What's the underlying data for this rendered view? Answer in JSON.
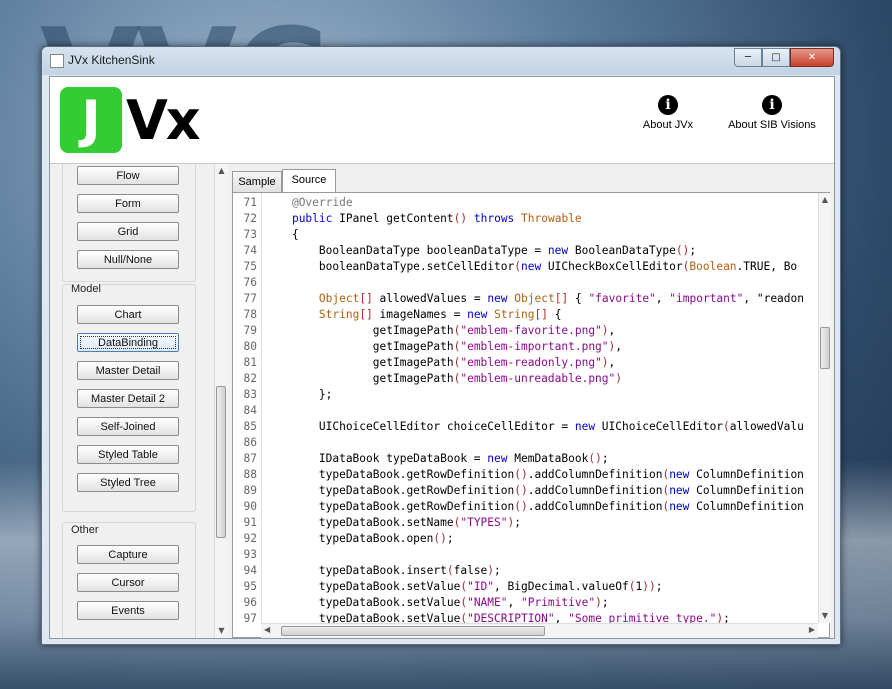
{
  "window": {
    "title": "JVx KitchenSink"
  },
  "header": {
    "logo_letter": "J",
    "logo_rest": "Vx",
    "about_jvx": "About JVx",
    "about_sib": "About SIB Visions"
  },
  "sidebar": {
    "top_buttons": [
      "Flow",
      "Form",
      "Grid",
      "Null/None"
    ],
    "model_label": "Model",
    "model_buttons": [
      "Chart",
      "DataBinding",
      "Master Detail",
      "Master Detail 2",
      "Self-Joined",
      "Styled Table",
      "Styled Tree"
    ],
    "other_label": "Other",
    "other_buttons": [
      "Capture",
      "Cursor",
      "Events"
    ]
  },
  "tabs": [
    "Sample",
    "Source"
  ],
  "code_lines": [
    {
      "n": "71",
      "code": "    @Override"
    },
    {
      "n": "72",
      "code": "    public IPanel getContent() throws Throwable"
    },
    {
      "n": "73",
      "code": "    {"
    },
    {
      "n": "74",
      "code": "        BooleanDataType booleanDataType = new BooleanDataType();"
    },
    {
      "n": "75",
      "code": "        booleanDataType.setCellEditor(new UICheckBoxCellEditor(Boolean.TRUE, Bo"
    },
    {
      "n": "76",
      "code": ""
    },
    {
      "n": "77",
      "code": "        Object[] allowedValues = new Object[] { \"favorite\", \"important\", \"readon"
    },
    {
      "n": "78",
      "code": "        String[] imageNames = new String[] {"
    },
    {
      "n": "79",
      "code": "                getImagePath(\"emblem-favorite.png\"),"
    },
    {
      "n": "80",
      "code": "                getImagePath(\"emblem-important.png\"),"
    },
    {
      "n": "81",
      "code": "                getImagePath(\"emblem-readonly.png\"),"
    },
    {
      "n": "82",
      "code": "                getImagePath(\"emblem-unreadable.png\")"
    },
    {
      "n": "83",
      "code": "        };"
    },
    {
      "n": "84",
      "code": ""
    },
    {
      "n": "85",
      "code": "        UIChoiceCellEditor choiceCellEditor = new UIChoiceCellEditor(allowedValu"
    },
    {
      "n": "86",
      "code": ""
    },
    {
      "n": "87",
      "code": "        IDataBook typeDataBook = new MemDataBook();"
    },
    {
      "n": "88",
      "code": "        typeDataBook.getRowDefinition().addColumnDefinition(new ColumnDefinition"
    },
    {
      "n": "89",
      "code": "        typeDataBook.getRowDefinition().addColumnDefinition(new ColumnDefinition"
    },
    {
      "n": "90",
      "code": "        typeDataBook.getRowDefinition().addColumnDefinition(new ColumnDefinition"
    },
    {
      "n": "91",
      "code": "        typeDataBook.setName(\"TYPES\");"
    },
    {
      "n": "92",
      "code": "        typeDataBook.open();"
    },
    {
      "n": "93",
      "code": ""
    },
    {
      "n": "94",
      "code": "        typeDataBook.insert(false);"
    },
    {
      "n": "95",
      "code": "        typeDataBook.setValue(\"ID\", BigDecimal.valueOf(1));"
    },
    {
      "n": "96",
      "code": "        typeDataBook.setValue(\"NAME\", \"Primitive\");"
    },
    {
      "n": "97",
      "code": "        typeDataBook.setValue(\"DESCRIPTION\", \"Some primitive type.\");"
    }
  ],
  "colors": {
    "logo_green": "#33cc33",
    "keyword": "#0000cc",
    "type": "#b06010",
    "string": "#8a0a8a"
  }
}
